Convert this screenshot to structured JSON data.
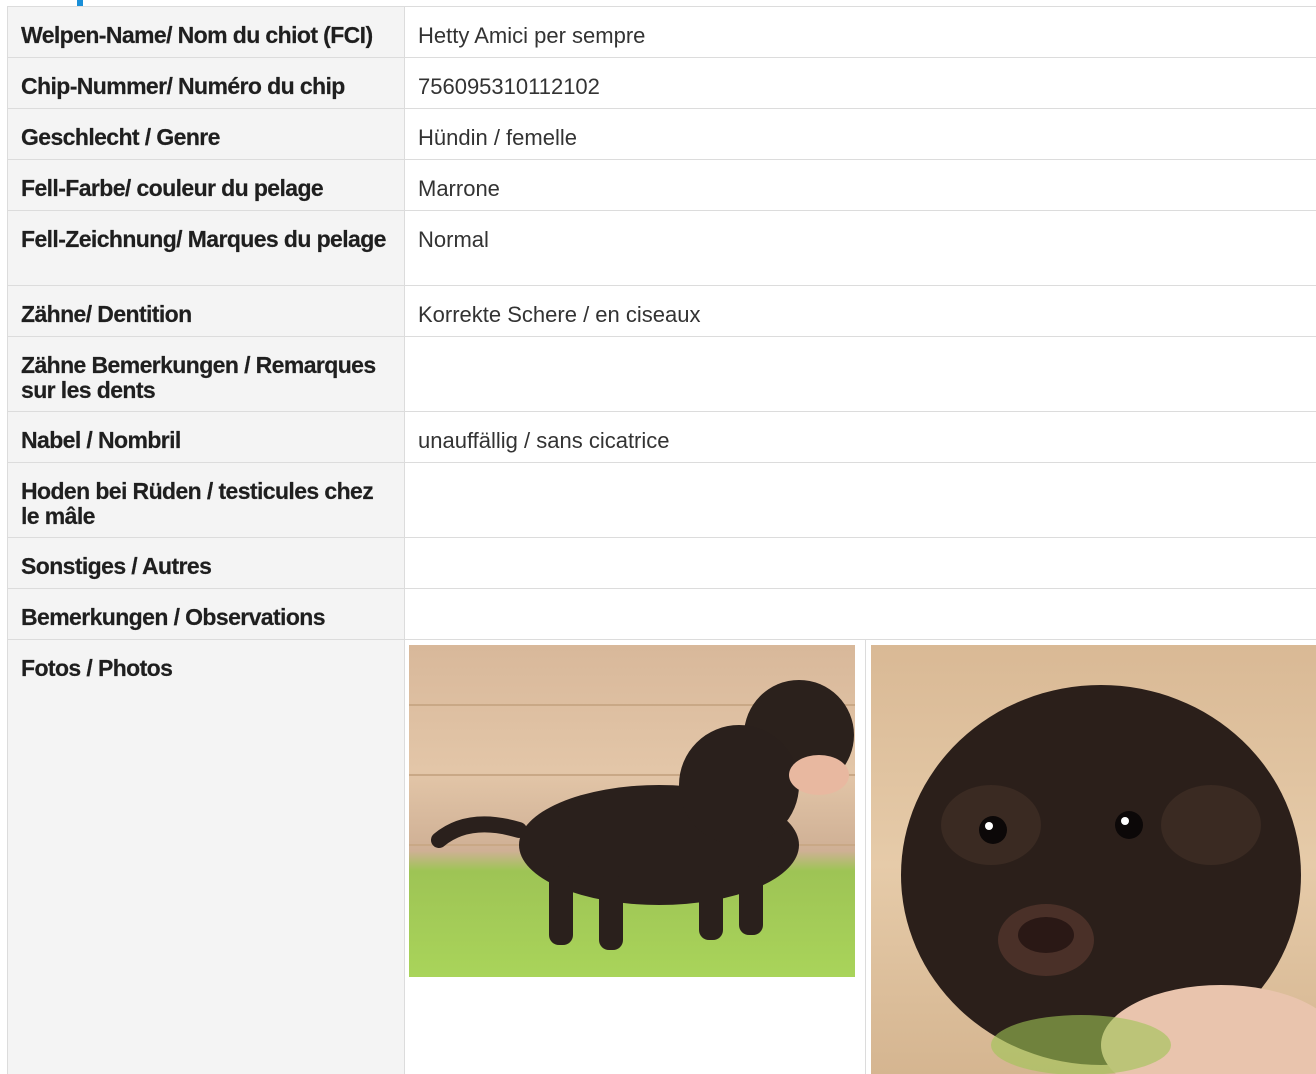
{
  "rows": [
    {
      "label": "Welpen-Name/ Nom du chiot (FCI)",
      "value": "Hetty Amici per sempre"
    },
    {
      "label": "Chip-Nummer/ Numéro du chip",
      "value": "756095310112102"
    },
    {
      "label": "Geschlecht / Genre",
      "value": "Hündin / femelle"
    },
    {
      "label": "Fell-Farbe/ couleur du pelage",
      "value": "Marrone"
    },
    {
      "label": "Fell-Zeichnung/ Marques du pelage",
      "value": "Normal"
    },
    {
      "label": "Zähne/ Dentition",
      "value": "Korrekte Schere / en ciseaux"
    },
    {
      "label": "Zähne Bemerkungen / Remarques sur les dents",
      "value": ""
    },
    {
      "label": "Nabel / Nombril",
      "value": "unauffällig / sans cicatrice"
    },
    {
      "label": "Hoden bei Rüden / testicules chez le mâle",
      "value": ""
    },
    {
      "label": "Sonstiges / Autres",
      "value": ""
    },
    {
      "label": "Bemerkungen / Observations",
      "value": ""
    }
  ],
  "photos": {
    "label": "Fotos / Photos"
  },
  "colors": {
    "accent": "#1a8fd8",
    "label_bg": "#f4f4f4",
    "border": "#dcdcdc"
  }
}
